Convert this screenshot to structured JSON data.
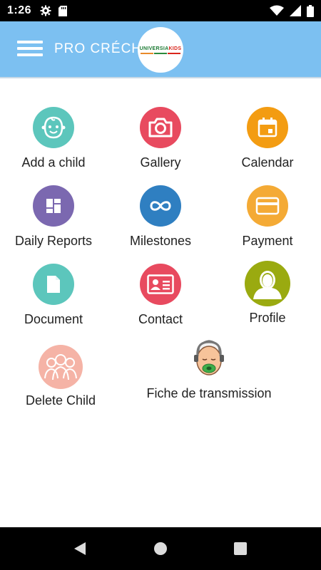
{
  "status_bar": {
    "time": "1:26"
  },
  "app_bar": {
    "title": "PRO CRÉCHE",
    "logo_text_a": "UNIVERSIA",
    "logo_text_b": "KIDS"
  },
  "colors": {
    "app_bar": "#7cc0f1",
    "teal": "#5cc6bc",
    "red": "#e84a5f",
    "orange": "#f39c12",
    "purple": "#7b68b0",
    "blue": "#2f7fc1",
    "olive": "#9aaa10",
    "pink": "#f5b3a6"
  },
  "menu": {
    "add_child": "Add a child",
    "gallery": "Gallery",
    "calendar": "Calendar",
    "daily_reports": "Daily Reports",
    "milestones": "Milestones",
    "payment": "Payment",
    "document": "Document",
    "contact": "Contact",
    "profile": "Profile",
    "delete_child": "Delete Child",
    "fiche": "Fiche de transmission"
  }
}
